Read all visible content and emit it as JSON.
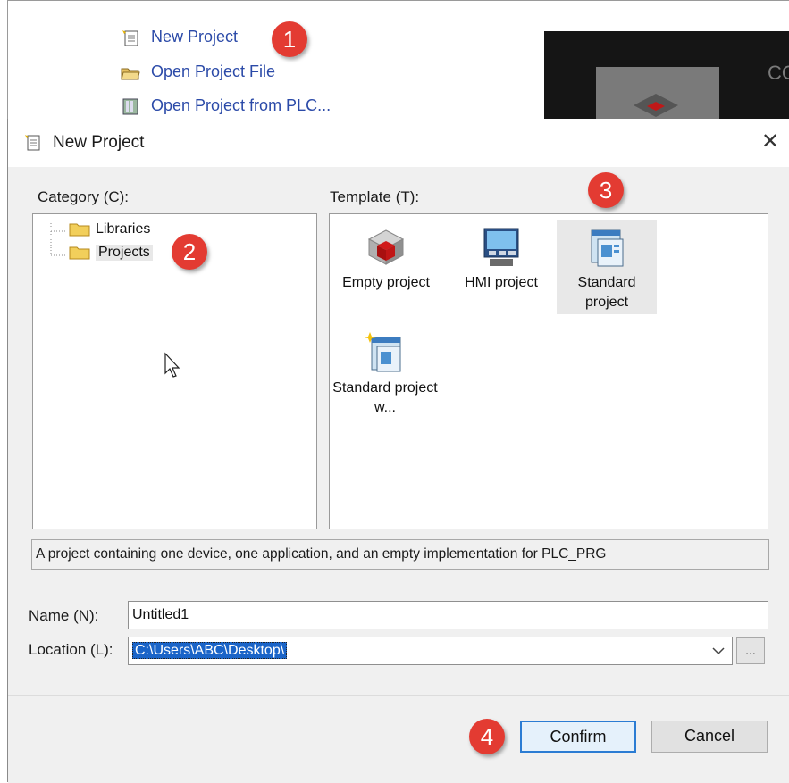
{
  "start_page": {
    "links": [
      {
        "label": "New Project",
        "icon": "new-project-icon"
      },
      {
        "label": "Open Project File",
        "icon": "open-folder-icon"
      },
      {
        "label": "Open Project from PLC...",
        "icon": "plc-icon"
      }
    ],
    "video_text": "CO"
  },
  "dialog": {
    "title": "New Project",
    "close_glyph": "✕",
    "category_label": "Category (C):",
    "template_label": "Template (T):",
    "categories": [
      {
        "label": "Libraries",
        "icon": "folder-icon"
      },
      {
        "label": "Projects",
        "icon": "folder-icon",
        "selected": true
      }
    ],
    "templates": [
      {
        "label": "Empty project",
        "icon": "empty-project-icon"
      },
      {
        "label": "HMI project",
        "icon": "hmi-project-icon"
      },
      {
        "label": "Standard project",
        "icon": "standard-project-icon",
        "selected": true
      },
      {
        "label": "Standard project w...",
        "icon": "standard-project-wizard-icon"
      }
    ],
    "description": "A project containing one device, one application, and an empty implementation for PLC_PRG",
    "name_label": "Name (N):",
    "name_value": "Untitled1",
    "location_label": "Location (L):",
    "location_value": "C:\\Users\\ABC\\Desktop\\",
    "browse_label": "...",
    "confirm_label": "Confirm",
    "cancel_label": "Cancel"
  },
  "step_badges": [
    "1",
    "2",
    "3",
    "4"
  ],
  "colors": {
    "badge": "#e33b32",
    "link": "#2b4aa8",
    "selection": "#1a64c8",
    "primary_border": "#2b7cd3"
  }
}
